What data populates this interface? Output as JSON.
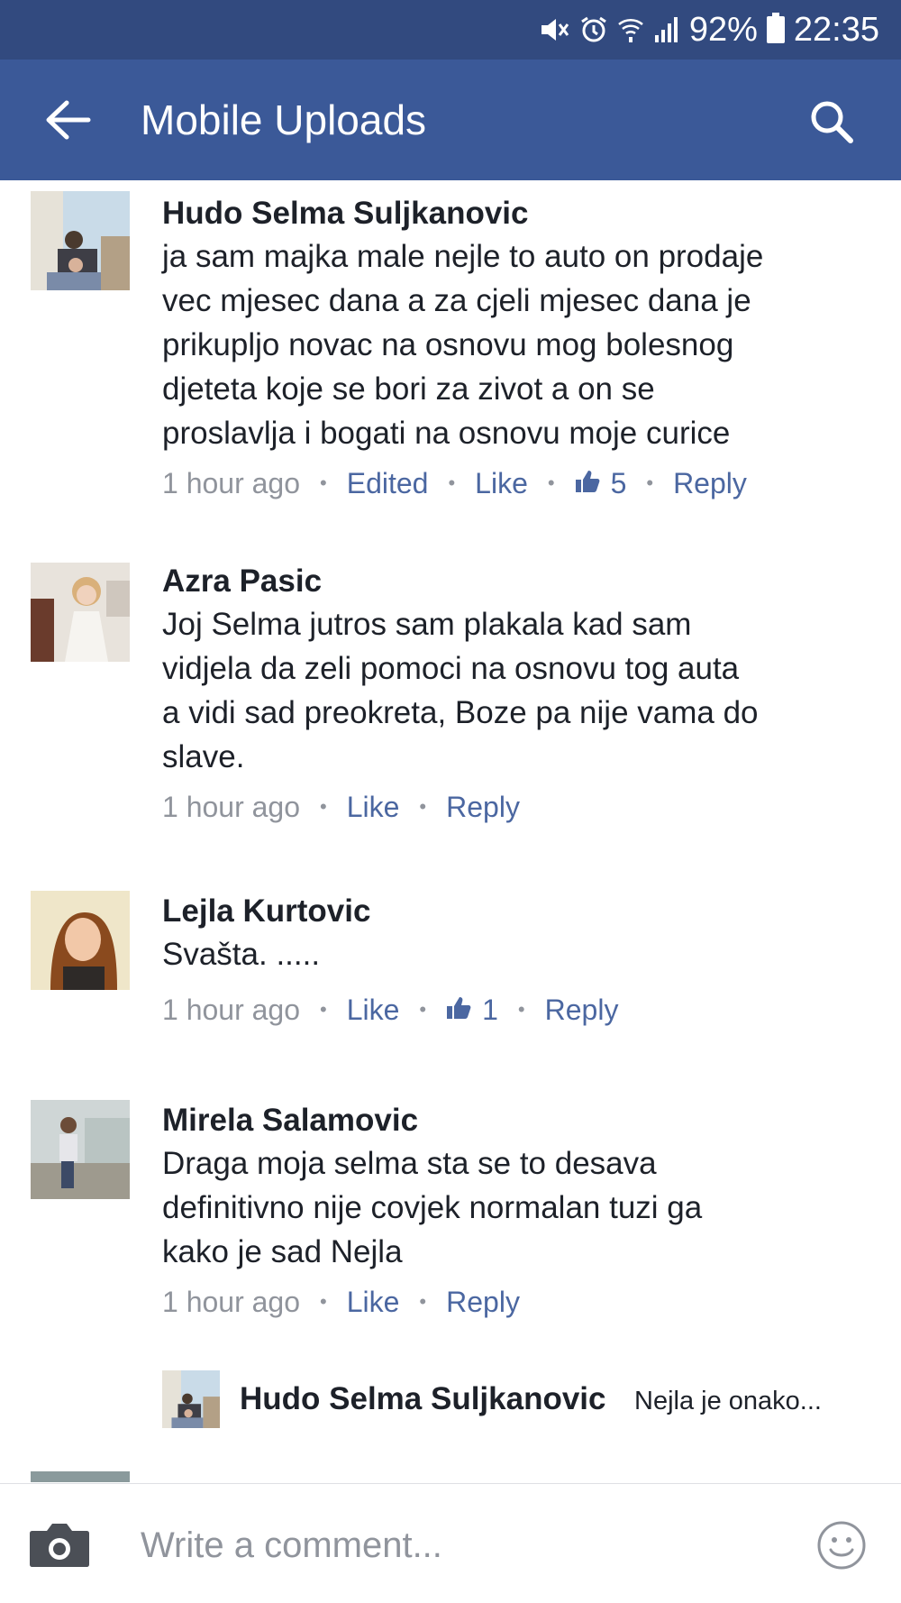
{
  "status_bar": {
    "battery": "92%",
    "time": "22:35"
  },
  "app_bar": {
    "title": "Mobile Uploads"
  },
  "comments": [
    {
      "name": "Hudo Selma Suljkanovic",
      "lines": [
        "ja sam majka male nejle to auto on prodaje",
        "vec mjesec dana a za cjeli mjesec dana je",
        "prikupljo novac na osnovu mog bolesnog",
        "djeteta koje se bori za zivot a on se",
        "proslavlja i bogati na osnovu moje curice"
      ],
      "time": "1 hour ago",
      "edited": "Edited",
      "like": "Like",
      "like_count": "5",
      "reply": "Reply"
    },
    {
      "name": "Azra Pasic",
      "lines": [
        "Joj Selma jutros sam plakala kad sam",
        "vidjela da zeli pomoci na osnovu tog auta",
        "a vidi sad preokreta, Boze pa nije vama do",
        "slave."
      ],
      "time": "1 hour ago",
      "like": "Like",
      "reply": "Reply"
    },
    {
      "name": "Lejla Kurtovic",
      "lines": [
        "Svašta. ....."
      ],
      "time": "1 hour ago",
      "like": "Like",
      "like_count": "1",
      "reply": "Reply"
    },
    {
      "name": "Mirela Salamovic",
      "lines": [
        "Draga moja selma sta se to desava",
        "definitivno nije covjek normalan tuzi ga",
        "kako je sad Nejla"
      ],
      "time": "1 hour ago",
      "like": "Like",
      "reply": "Reply"
    }
  ],
  "reply_preview": {
    "name": "Hudo Selma Suljkanovic",
    "text": "Nejla je onako..."
  },
  "composer": {
    "placeholder": "Write a comment..."
  },
  "colors": {
    "status_bar": "#324a7f",
    "app_bar": "#3b5998",
    "link": "#4b67a1",
    "meta_gray": "#90949c"
  },
  "icons": {
    "back": "arrow-left-icon",
    "search": "search-icon",
    "camera": "camera-icon",
    "emoji": "smiley-icon",
    "like": "thumbs-up-icon"
  }
}
